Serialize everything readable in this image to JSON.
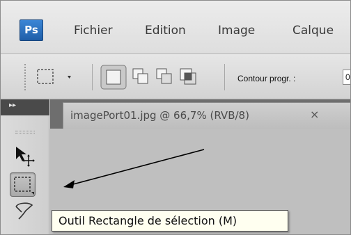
{
  "app": {
    "logo": "Ps",
    "menu": [
      "Fichier",
      "Edition",
      "Image",
      "Calque"
    ]
  },
  "options_bar": {
    "feather_label": "Contour progr. :",
    "feather_value": "0"
  },
  "document": {
    "tab_title": "imagePort01.jpg @ 66,7% (RVB/8)",
    "close_glyph": "×"
  },
  "toolbar": {
    "collapse_glyph": "▸▸"
  },
  "tooltip": {
    "text": "Outil Rectangle de sélection (M)"
  },
  "icons": {
    "move_tool": "move-icon",
    "rectangular_marquee": "rectangular-marquee-icon",
    "lasso": "lasso-icon"
  },
  "colors": {
    "ps_logo": "#2f74c6",
    "tooltip_bg": "#fffff0",
    "doc_area": "#6e6e6e"
  }
}
